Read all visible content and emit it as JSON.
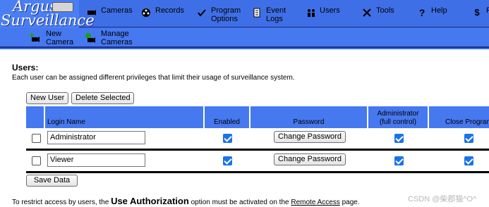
{
  "logo": {
    "line1": "Argus",
    "line2": "Surveillance"
  },
  "nav_primary": [
    {
      "label": "Cameras",
      "icon": "camera-icon"
    },
    {
      "label": "Records",
      "icon": "film-reel-icon"
    },
    {
      "label": "Program\nOptions",
      "icon": "checkmark-icon"
    },
    {
      "label": "Event\nLogs",
      "icon": "document-icon"
    },
    {
      "label": "Users",
      "icon": "users-icon"
    },
    {
      "label": "Tools",
      "icon": "tools-icon"
    },
    {
      "label": "Help",
      "icon": "question-icon"
    },
    {
      "label": "F",
      "icon": "dollar-icon"
    }
  ],
  "nav_secondary": [
    {
      "label": "New\nCamera",
      "icon": "new-camera-icon"
    },
    {
      "label": "Manage\nCameras",
      "icon": "manage-cameras-icon"
    }
  ],
  "page": {
    "title": "Users:",
    "description": "Each user can be assigned different privileges that limit their usage of surveillance system."
  },
  "toolbar": {
    "new_user": "New User",
    "delete_selected": "Delete Selected"
  },
  "table": {
    "headers": {
      "login": "Login Name",
      "enabled": "Enabled",
      "password": "Password",
      "admin": "Administrator\n(full control)",
      "close": "Close Program"
    },
    "rows": [
      {
        "login": "Administrator",
        "change_password": "Change Password",
        "selected": false,
        "enabled": true,
        "admin": true,
        "close": true
      },
      {
        "login": "Viewer",
        "change_password": "Change Password",
        "selected": false,
        "enabled": true,
        "admin": true,
        "close": true
      }
    ]
  },
  "save_label": "Save Data",
  "footer": {
    "pre": "To restrict access by users, the ",
    "emph": "Use Authorization",
    "mid": " option must be activated on the ",
    "link": "Remote Access",
    "post": " page."
  },
  "watermark": "CSDN @柴郡猫^O^"
}
